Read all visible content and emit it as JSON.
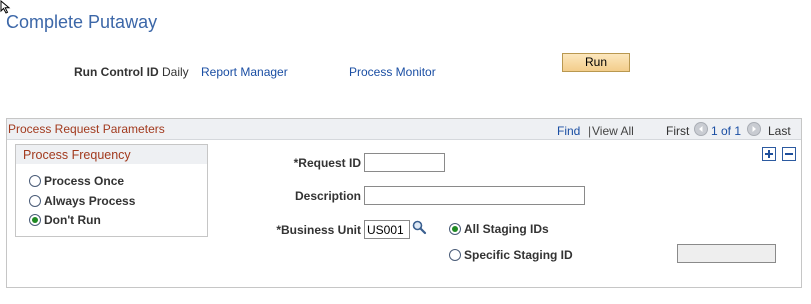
{
  "page": {
    "title": "Complete Putaway"
  },
  "run_control": {
    "label": "Run Control ID",
    "value": "Daily",
    "report_manager": "Report Manager",
    "process_monitor": "Process Monitor",
    "run_button": "Run"
  },
  "panel": {
    "title": "Process Request Parameters",
    "find": "Find",
    "separator": "|",
    "view_all": "View All",
    "first": "First",
    "pager": "1 of 1",
    "last": "Last"
  },
  "frequency": {
    "title": "Process Frequency",
    "options": [
      {
        "label": "Process Once",
        "checked": false
      },
      {
        "label": "Always Process",
        "checked": false
      },
      {
        "label": "Don't Run",
        "checked": true
      }
    ]
  },
  "fields": {
    "request_id": {
      "label": "*Request ID",
      "value": ""
    },
    "description": {
      "label": "Description",
      "value": ""
    },
    "business_unit": {
      "label": "*Business Unit",
      "value": "US001"
    }
  },
  "staging": {
    "all_label": "All Staging IDs",
    "all_checked": true,
    "specific_label": "Specific Staging ID",
    "specific_checked": false,
    "specific_value": ""
  },
  "colors": {
    "title_blue": "#3c67a8",
    "link_blue": "#1a4ea3",
    "section_title": "#a23a1e",
    "radio_selected": "#1f8a23"
  },
  "icons": {
    "cursor": "mouse-pointer-icon",
    "prev": "previous-arrow-icon",
    "next": "next-arrow-icon",
    "add": "plus-icon",
    "delete": "minus-icon",
    "lookup": "magnifying-glass-icon"
  }
}
